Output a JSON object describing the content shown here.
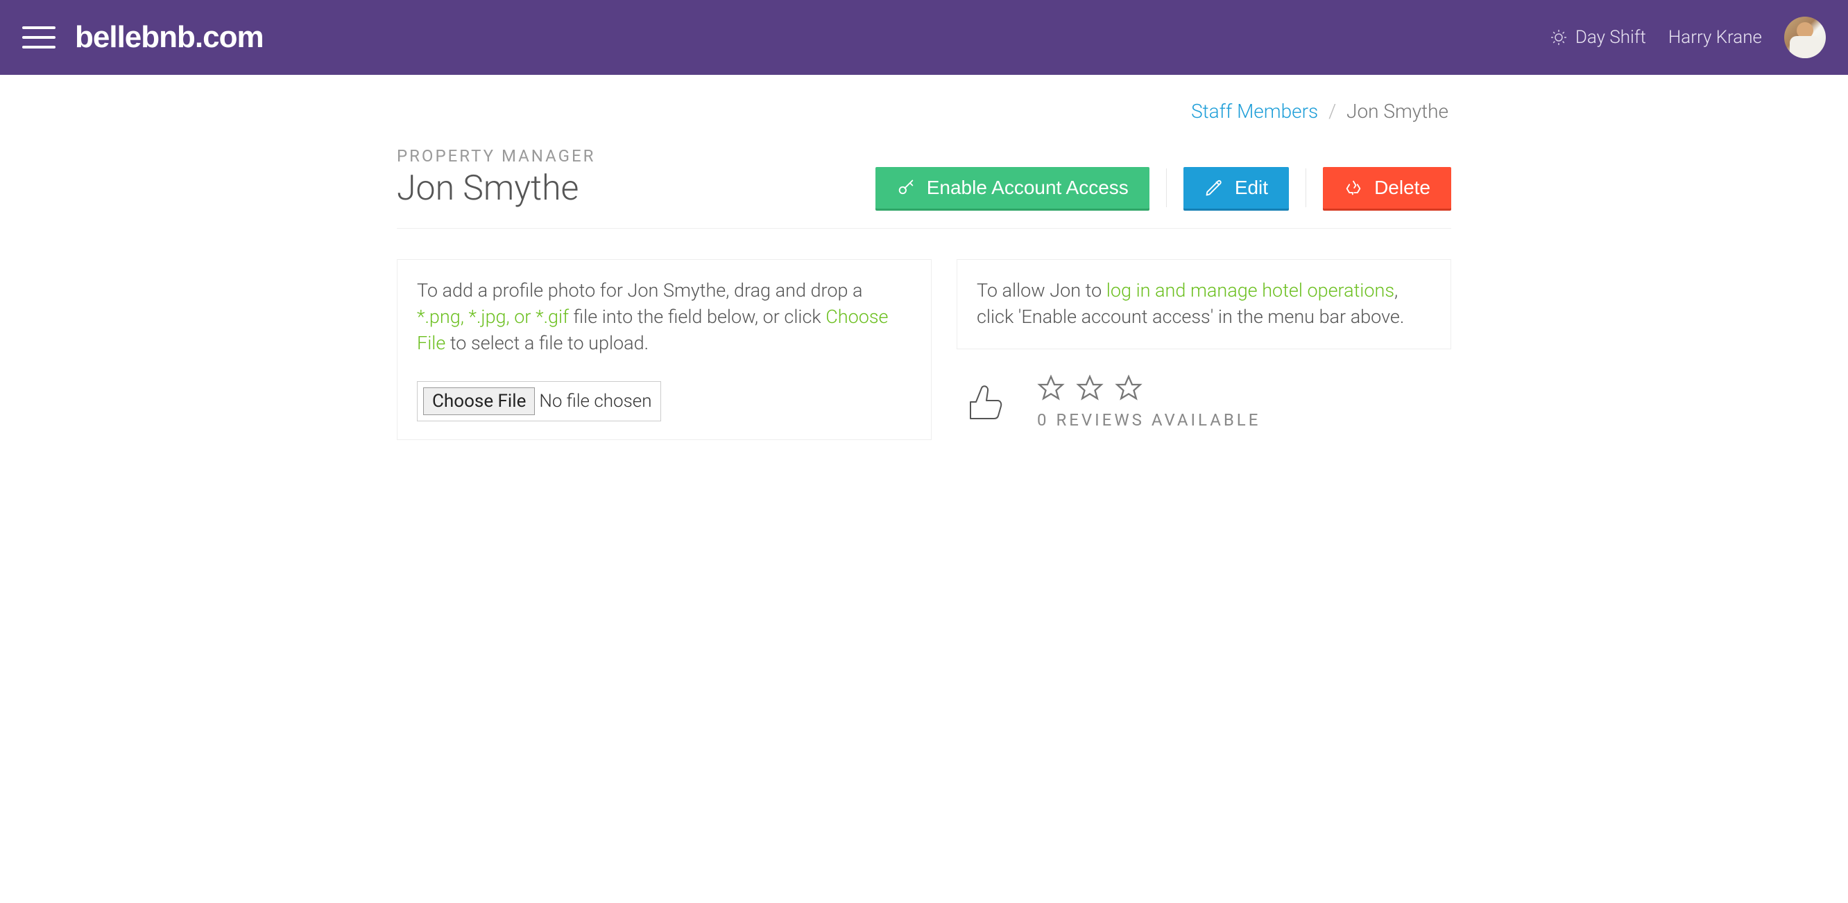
{
  "header": {
    "logo": "bellebnb.com",
    "shift_label": "Day Shift",
    "user_name": "Harry Krane"
  },
  "breadcrumb": {
    "parent": "Staff Members",
    "current": "Jon Smythe"
  },
  "title": {
    "role": "PROPERTY MANAGER",
    "name": "Jon Smythe"
  },
  "actions": {
    "enable_label": "Enable Account Access",
    "edit_label": "Edit",
    "delete_label": "Delete"
  },
  "upload_card": {
    "lead": "To add a profile photo for Jon Smythe, drag and drop a ",
    "filetypes": "*.png, *.jpg, or *.gif",
    "mid": " file into the field below, or click ",
    "choose": "Choose File",
    "tail": " to select a file to upload.",
    "btn_label": "Choose File",
    "no_file": "No file chosen"
  },
  "access_card": {
    "lead": "To allow Jon to ",
    "link_text": "log in and manage hotel operations",
    "tail": ", click 'Enable account access' in the menu bar above."
  },
  "reviews": {
    "label": "0 REVIEWS AVAILABLE"
  }
}
